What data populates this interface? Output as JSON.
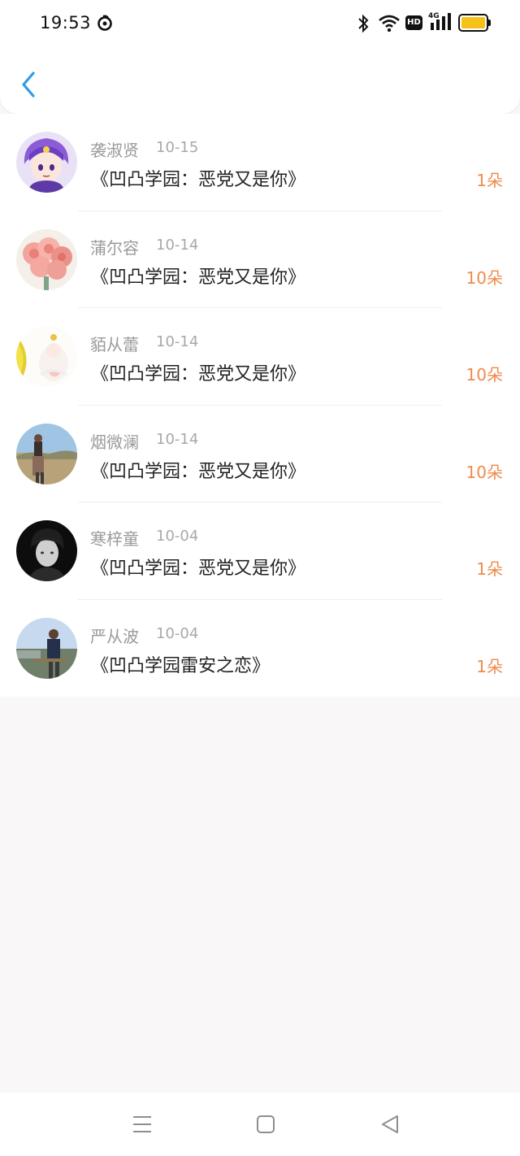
{
  "status_bar": {
    "time": "19:53",
    "network_type": "4G",
    "hd_badge": "HD"
  },
  "header": {
    "back_icon": "chevron-left-icon"
  },
  "colors": {
    "accent": "#2f9be8",
    "count": "#f08a4b"
  },
  "items": [
    {
      "name": "袭淑贤",
      "date": "10-15",
      "book": "《凹凸学园：恶党又是你》",
      "count": "1朵"
    },
    {
      "name": "蒲尔容",
      "date": "10-14",
      "book": "《凹凸学园：恶党又是你》",
      "count": "10朵"
    },
    {
      "name": "貊从蕾",
      "date": "10-14",
      "book": "《凹凸学园：恶党又是你》",
      "count": "10朵"
    },
    {
      "name": "烟微澜",
      "date": "10-14",
      "book": "《凹凸学园：恶党又是你》",
      "count": "10朵"
    },
    {
      "name": "寒梓童",
      "date": "10-04",
      "book": "《凹凸学园：恶党又是你》",
      "count": "1朵"
    },
    {
      "name": "严从波",
      "date": "10-04",
      "book": "《凹凸学园雷安之恋》",
      "count": "1朵"
    }
  ],
  "nav": {
    "menu_icon": "menu-icon",
    "home_icon": "home-square-icon",
    "back_icon": "back-triangle-icon"
  }
}
